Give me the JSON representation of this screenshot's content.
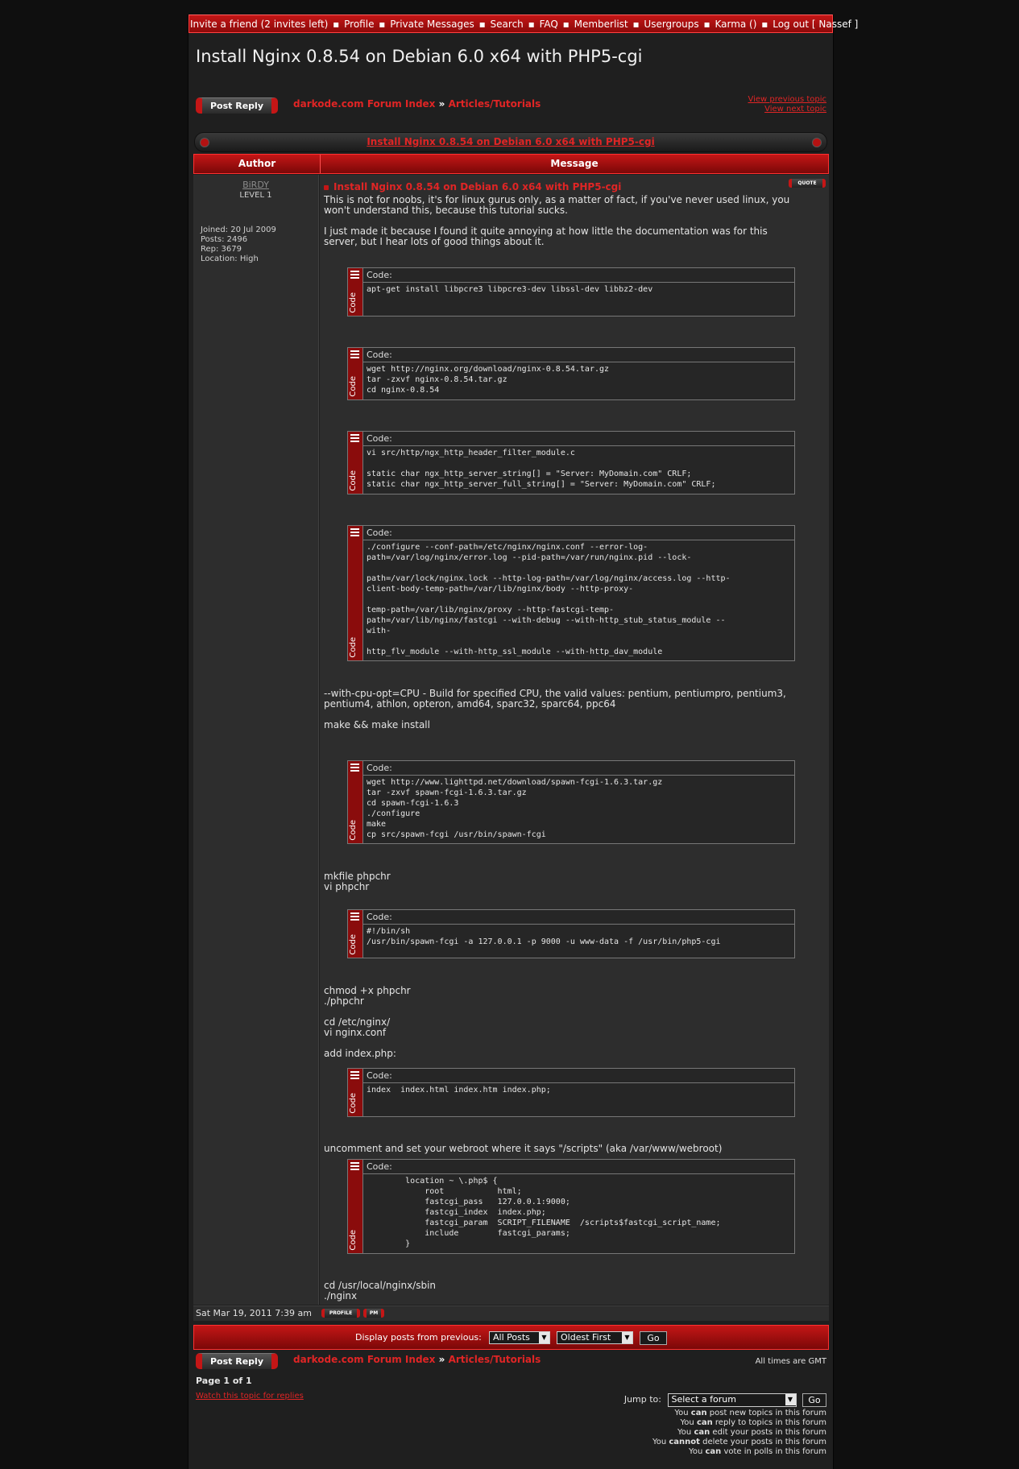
{
  "topnav": [
    "Invite a friend (2 invites left)",
    "Profile",
    "Private Messages",
    "Search",
    "FAQ",
    "Memberlist",
    "Usergroups",
    "Karma ()",
    "Log out [ Nassef ]"
  ],
  "topnav_sep": "▪",
  "page_title": "Install Nginx 0.8.54 on Debian 6.0 x64 with PHP5-cgi",
  "post_reply": "Post Reply",
  "breadcrumb": {
    "index": "darkode.com Forum Index",
    "sep": "»",
    "forum": "Articles/Tutorials"
  },
  "topic_links": {
    "prev": "View previous topic",
    "next": "View next topic"
  },
  "table_title": "Install Nginx 0.8.54 on Debian 6.0 x64 with PHP5-cgi",
  "headers": {
    "author": "Author",
    "message": "Message"
  },
  "author": {
    "name": "BiRDY",
    "level": "LEVEL 1",
    "joined": "Joined: 20 Jul 2009",
    "posts": "Posts: 2496",
    "rep": "Rep: 3679",
    "location": "Location: High"
  },
  "post": {
    "title": "Install Nginx 0.8.54 on Debian 6.0 x64 with PHP5-cgi",
    "quote": "QUOTE",
    "code_label": "Code:",
    "code_side": "Code",
    "texts": [
      "This is not for noobs, it's for linux gurus only, as a matter of fact, if you've never used linux, you\nwon't understand this, because this tutorial sucks.\n\nI just made it because I found it quite annoying at how little the documentation was for this\nserver, but I hear lots of good things about it.",
      "--with-cpu-opt=CPU - Build for specified CPU, the valid values: pentium, pentiumpro, pentium3,\npentium4, athlon, opteron, amd64, sparc32, sparc64, ppc64\n\nmake && make install",
      "mkfile phpchr\nvi phpchr",
      "chmod +x phpchr\n./phpchr\n\ncd /etc/nginx/\nvi nginx.conf\n\nadd index.php:",
      "uncomment and set your webroot where it says \"/scripts\" (aka /var/www/webroot)",
      "cd /usr/local/nginx/sbin\n./nginx"
    ],
    "codes": [
      "apt-get install libpcre3 libpcre3-dev libssl-dev libbz2-dev",
      "wget http://nginx.org/download/nginx-0.8.54.tar.gz\ntar -zxvf nginx-0.8.54.tar.gz\ncd nginx-0.8.54",
      "vi src/http/ngx_http_header_filter_module.c\n\nstatic char ngx_http_server_string[] = \"Server: MyDomain.com\" CRLF;\nstatic char ngx_http_server_full_string[] = \"Server: MyDomain.com\" CRLF;",
      "./configure --conf-path=/etc/nginx/nginx.conf --error-log-\npath=/var/log/nginx/error.log --pid-path=/var/run/nginx.pid --lock-\n\npath=/var/lock/nginx.lock --http-log-path=/var/log/nginx/access.log --http-\nclient-body-temp-path=/var/lib/nginx/body --http-proxy-\n\ntemp-path=/var/lib/nginx/proxy --http-fastcgi-temp-\npath=/var/lib/nginx/fastcgi --with-debug --with-http_stub_status_module --\nwith-\n\nhttp_flv_module --with-http_ssl_module --with-http_dav_module",
      "wget http://www.lighttpd.net/download/spawn-fcgi-1.6.3.tar.gz\ntar -zxvf spawn-fcgi-1.6.3.tar.gz\ncd spawn-fcgi-1.6.3\n./configure\nmake\ncp src/spawn-fcgi /usr/bin/spawn-fcgi",
      "#!/bin/sh\n/usr/bin/spawn-fcgi -a 127.0.0.1 -p 9000 -u www-data -f /usr/bin/php5-cgi",
      "index  index.html index.htm index.php;",
      "        location ~ \\.php$ {\n            root           html;\n            fastcgi_pass   127.0.0.1:9000;\n            fastcgi_index  index.php;\n            fastcgi_param  SCRIPT_FILENAME  /scripts$fastcgi_script_name;\n            include        fastcgi_params;\n        }"
    ]
  },
  "post_date": "Sat Mar 19, 2011 7:39 am",
  "profile_btn": "PROFILE",
  "pm_btn": "PM",
  "display": {
    "label": "Display posts from previous:",
    "posts_value": "All Posts",
    "order_value": "Oldest First",
    "go": "Go"
  },
  "all_times": "All times are GMT",
  "page_info": "Page 1 of 1",
  "watch": "Watch this topic for replies",
  "jump": {
    "label": "Jump to:",
    "value": "Select a forum",
    "go": "Go"
  },
  "permissions": [
    [
      "You ",
      "can",
      " post new topics in this forum"
    ],
    [
      "You ",
      "can",
      " reply to topics in this forum"
    ],
    [
      "You ",
      "can",
      " edit your posts in this forum"
    ],
    [
      "You ",
      "cannot",
      " delete your posts in this forum"
    ],
    [
      "You ",
      "can",
      " vote in polls in this forum"
    ]
  ],
  "colors": {
    "accent": "#c41616",
    "link": "#e02525",
    "panel": "#2d2d2d",
    "bg": "#1f1f1f"
  }
}
